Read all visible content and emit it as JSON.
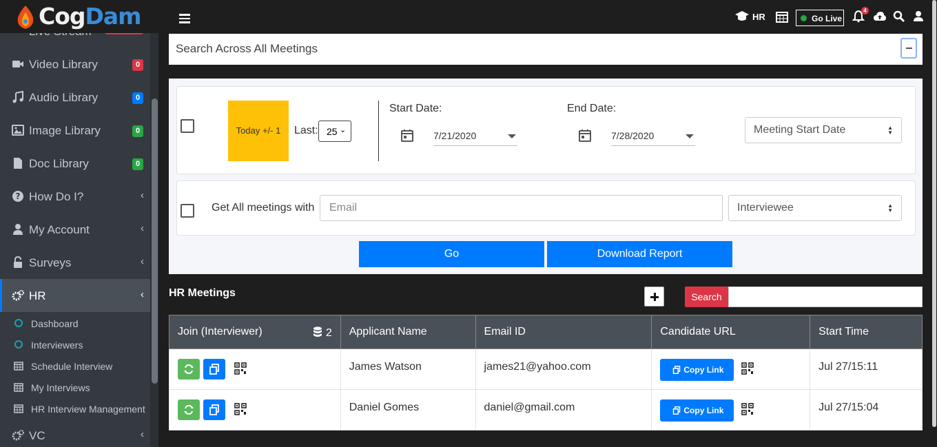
{
  "brand": {
    "part1": "Cog",
    "part2": "Dam"
  },
  "sidebar": {
    "peek_label": "Live Stream",
    "items": [
      {
        "label": "Video Library",
        "icon": "video-icon",
        "badge": "0",
        "badge_color": "#dc3545"
      },
      {
        "label": "Audio Library",
        "icon": "music-icon",
        "badge": "0",
        "badge_color": "#007bff"
      },
      {
        "label": "Image Library",
        "icon": "image-icon",
        "badge": "0",
        "badge_color": "#28a745"
      },
      {
        "label": "Doc Library",
        "icon": "file-icon",
        "badge": "0",
        "badge_color": "#28a745"
      },
      {
        "label": "How Do I?",
        "icon": "question-icon"
      },
      {
        "label": "My Account",
        "icon": "user-icon"
      },
      {
        "label": "Surveys",
        "icon": "lock-icon"
      },
      {
        "label": "HR",
        "icon": "cogs-icon"
      },
      {
        "label": "VC",
        "icon": "cogs-icon"
      }
    ],
    "sub_items": [
      {
        "label": "Dashboard",
        "icon": "circle-icon"
      },
      {
        "label": "Interviewers",
        "icon": "circle-icon"
      },
      {
        "label": "Schedule Interview",
        "icon": "calendar-icon"
      },
      {
        "label": "My Interviews",
        "icon": "calendar-icon"
      },
      {
        "label": "HR Interview Management",
        "icon": "calendar-icon"
      }
    ]
  },
  "topbar": {
    "hr_label": "HR",
    "go_live_label": "Go Live",
    "notification_count": "4"
  },
  "search_all": {
    "label": "Search Across All Meetings"
  },
  "filters": {
    "today_label": "Today +/- 1",
    "last_label": "Last:",
    "last_value": "25",
    "start_label": "Start Date:",
    "start_value": "7/21/2020",
    "end_label": "End Date:",
    "end_value": "7/28/2020",
    "sort_value": "Meeting Start Date",
    "get_all_label": "Get All meetings with",
    "email_placeholder": "Email",
    "role_value": "Interviewee",
    "go_label": "Go",
    "download_label": "Download Report"
  },
  "meetings": {
    "title": "HR Meetings",
    "search_label": "Search",
    "count": "2",
    "columns": [
      "Join (Interviewer)",
      "Applicant Name",
      "Email ID",
      "Candidate URL",
      "Start Time"
    ],
    "copy_label": "Copy Link",
    "rows": [
      {
        "name": "James Watson",
        "email": "james21@yahoo.com",
        "start": "Jul 27/15:11"
      },
      {
        "name": "Daniel Gomes",
        "email": "daniel@gmail.com",
        "start": "Jul 27/15:04"
      }
    ]
  }
}
